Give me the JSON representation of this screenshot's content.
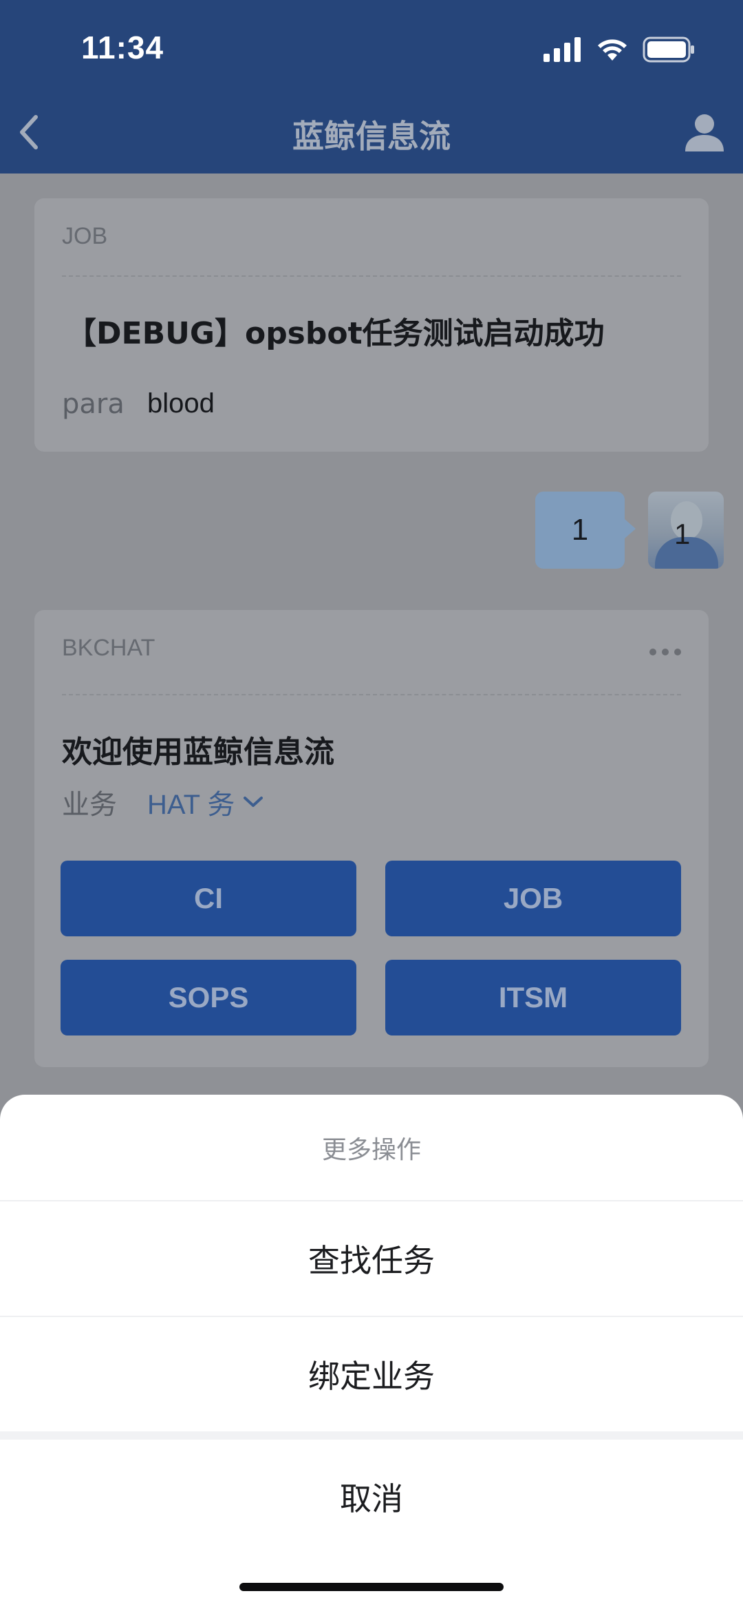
{
  "status_bar": {
    "time": "11:34"
  },
  "nav": {
    "title": "蓝鲸信息流"
  },
  "job_card": {
    "source": "JOB",
    "title": "【DEBUG】opsbot任务测试启动成功",
    "param_key": "para",
    "param_value": "blood"
  },
  "reply": {
    "text": "1",
    "avatar_glyph": "1"
  },
  "bkchat_card": {
    "source": "BKCHAT",
    "title": "欢迎使用蓝鲸信息流",
    "biz_label": "业务",
    "biz_value": "HAT 务 ",
    "buttons": [
      "CI",
      "JOB",
      "SOPS",
      "ITSM"
    ]
  },
  "action_sheet": {
    "title": "更多操作",
    "items": [
      "查找任务",
      "绑定业务"
    ],
    "cancel": "取消"
  },
  "colors": {
    "nav_bg": "#26457a",
    "button_bg": "#234d95",
    "overlay_bg": "#8f9196"
  }
}
